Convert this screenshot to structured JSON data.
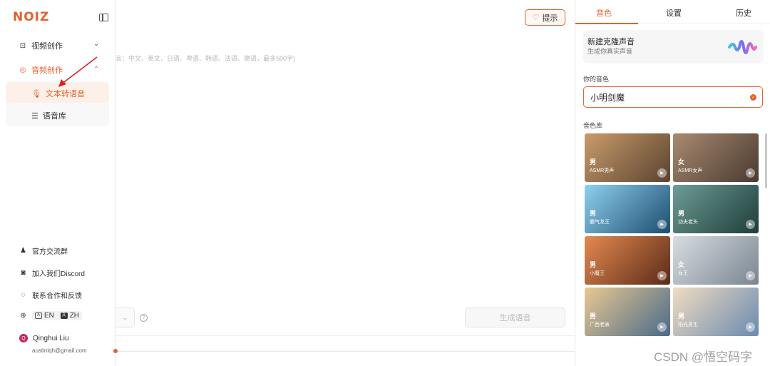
{
  "app": {
    "logo": "NOIZ"
  },
  "sidebar": {
    "video": {
      "label": "视频创作"
    },
    "audio": {
      "label": "音频创作"
    },
    "sub_items": [
      {
        "label": "文本转语音"
      },
      {
        "label": "语音库"
      }
    ],
    "footer": {
      "group": "官方交流群",
      "discord": "加入我们Discord",
      "feedback": "联系合作和反馈",
      "lang_en": "EN",
      "lang_zh": "ZH",
      "user_name": "Qinghui Liu",
      "user_email": "austinlqh@gmail.com",
      "avatar_initial": "Q"
    }
  },
  "main": {
    "hint_label": "提示",
    "placeholder": "言：中文、英文、日语、粤语、韩语、法语、德语，最多500字)",
    "generate_label": "生成语音",
    "help_glyph": "?"
  },
  "right_panel": {
    "tabs": [
      {
        "label": "音色"
      },
      {
        "label": "设置"
      },
      {
        "label": "历史"
      }
    ],
    "clone": {
      "title": "新建克隆声音",
      "subtitle": "生成你真实声音"
    },
    "your_voice_label": "你的音色",
    "your_voice_value": "小明剑魔",
    "library_label": "音色库",
    "voices": [
      {
        "gender": "男",
        "name": "ASMR男声",
        "color_a": "#5a4330",
        "color_b": "#c99b6a"
      },
      {
        "gender": "女",
        "name": "ASMR女声",
        "color_a": "#4a3a30",
        "color_b": "#a88a72"
      },
      {
        "gender": "男",
        "name": "霸气龙王",
        "color_a": "#1d4d6e",
        "color_b": "#8fd0f0"
      },
      {
        "gender": "男",
        "name": "功夫老头",
        "color_a": "#1e3d3a",
        "color_b": "#6e9c96"
      },
      {
        "gender": "男",
        "name": "小魔王",
        "color_a": "#5a2a18",
        "color_b": "#e48a50"
      },
      {
        "gender": "女",
        "name": "女王",
        "color_a": "#7a8590",
        "color_b": "#d7dde2"
      },
      {
        "gender": "男",
        "name": "广西老表",
        "color_a": "#4a6a8a",
        "color_b": "#e8c890"
      },
      {
        "gender": "男",
        "name": "阳光男生",
        "color_a": "#6a8ab0",
        "color_b": "#f0dcc0"
      }
    ]
  },
  "watermark": "CSDN @悟空码字",
  "colors": {
    "accent": "#e2622e"
  }
}
